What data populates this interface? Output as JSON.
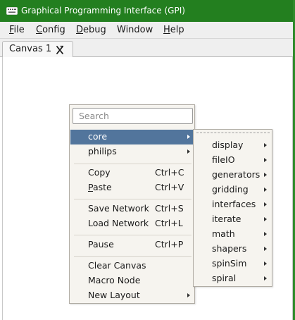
{
  "window": {
    "title": "Graphical Programming Interface (GPI)"
  },
  "menubar": [
    {
      "label": "File",
      "mnemonic": "F",
      "rest": "ile"
    },
    {
      "label": "Config",
      "mnemonic": "C",
      "rest": "onfig"
    },
    {
      "label": "Debug",
      "mnemonic": "D",
      "rest": "ebug"
    },
    {
      "label": "Window",
      "mnemonic": "",
      "rest": "Window"
    },
    {
      "label": "Help",
      "mnemonic": "H",
      "rest": "elp"
    }
  ],
  "tab": {
    "label": "Canvas 1"
  },
  "context_menu": {
    "search_placeholder": "Search",
    "items": [
      {
        "label": "core",
        "shortcut": "",
        "submenu": true,
        "active": true
      },
      {
        "label": "philips",
        "shortcut": "",
        "submenu": true,
        "active": false
      },
      {
        "label": "Copy",
        "shortcut": "Ctrl+C",
        "submenu": false,
        "active": false
      },
      {
        "label": "Paste",
        "mnemonic": "P",
        "rest": "aste",
        "shortcut": "Ctrl+V",
        "submenu": false,
        "active": false
      },
      {
        "label": "Save Network",
        "shortcut": "Ctrl+S",
        "submenu": false,
        "active": false
      },
      {
        "label": "Load Network",
        "shortcut": "Ctrl+L",
        "submenu": false,
        "active": false
      },
      {
        "label": "Pause",
        "shortcut": "Ctrl+P",
        "submenu": false,
        "active": false
      },
      {
        "label": "Clear Canvas",
        "shortcut": "",
        "submenu": false,
        "active": false
      },
      {
        "label": "Macro Node",
        "shortcut": "",
        "submenu": false,
        "active": false
      },
      {
        "label": "New Layout",
        "shortcut": "",
        "submenu": true,
        "active": false
      }
    ]
  },
  "submenu": {
    "items": [
      {
        "label": "display"
      },
      {
        "label": "fileIO"
      },
      {
        "label": "generators"
      },
      {
        "label": "gridding"
      },
      {
        "label": "interfaces"
      },
      {
        "label": "iterate"
      },
      {
        "label": "math"
      },
      {
        "label": "shapers"
      },
      {
        "label": "spinSim"
      },
      {
        "label": "spiral"
      }
    ]
  },
  "colors": {
    "titlebar": "#237f1f",
    "highlight": "#52759c",
    "menu_bg": "#f6f4ef"
  }
}
